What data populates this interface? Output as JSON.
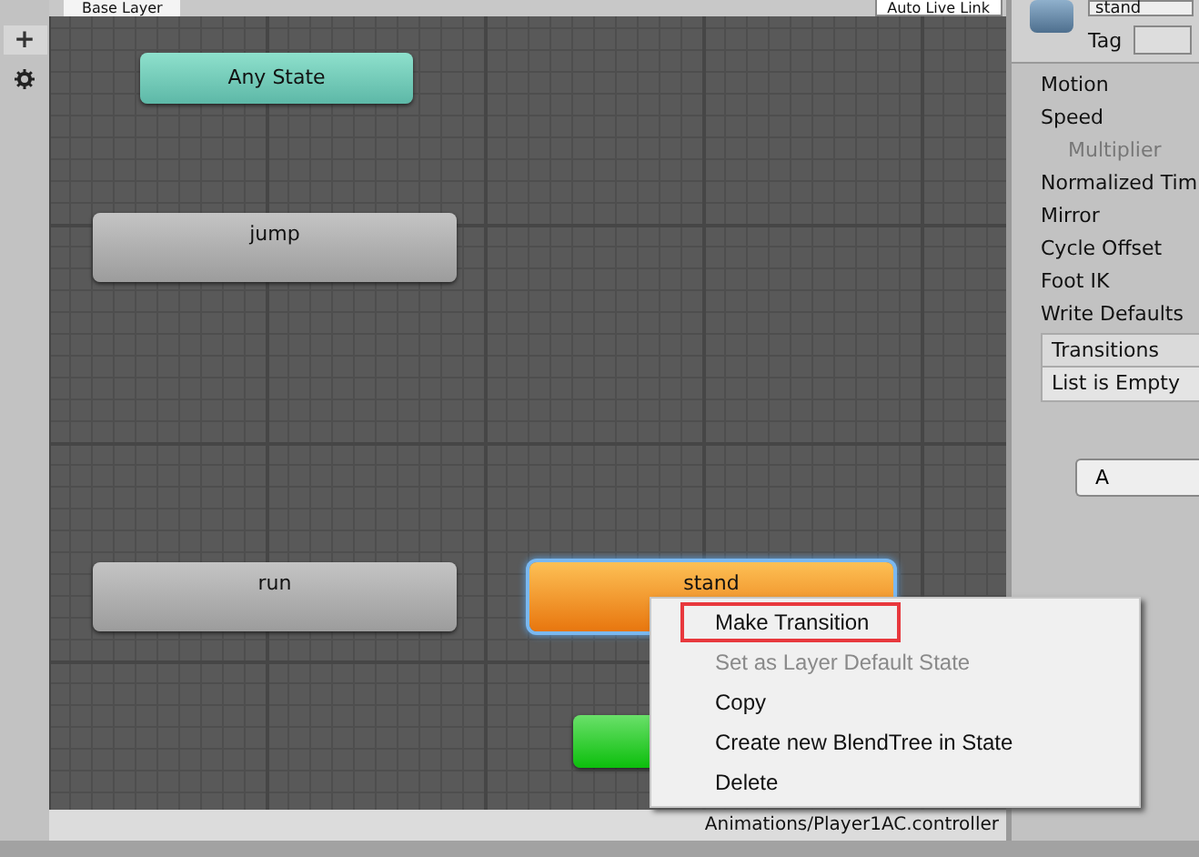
{
  "tabs": [
    {
      "label": "Base Layer",
      "selected": true
    }
  ],
  "live_link": {
    "label": "Auto Live Link",
    "checked": false
  },
  "toolbar": {
    "add": "+"
  },
  "graph": {
    "nodes": [
      {
        "label": "Any State",
        "kind": "any",
        "selected": false
      },
      {
        "label": "jump",
        "kind": "normal",
        "selected": false
      },
      {
        "label": "run",
        "kind": "normal",
        "selected": false
      },
      {
        "label": "stand",
        "kind": "default",
        "selected": true
      },
      {
        "kind": "entry",
        "selected": false
      }
    ]
  },
  "context_menu": [
    {
      "label": "Make Transition",
      "disabled": false,
      "marked": true
    },
    {
      "label": "Set as Layer Default State",
      "disabled": true,
      "marked": false
    },
    {
      "label": "Copy",
      "disabled": false,
      "marked": false
    },
    {
      "label": "Create new BlendTree in State",
      "disabled": false,
      "marked": false
    },
    {
      "label": "Delete",
      "disabled": false,
      "marked": false
    }
  ],
  "status_bar": {
    "path": "Animations/Player1AC.controller"
  },
  "inspector": {
    "name": "stand",
    "tag_label": "Tag",
    "properties": [
      {
        "label": "Motion",
        "disabled": false
      },
      {
        "label": "Speed",
        "disabled": false
      },
      {
        "label": "Multiplier",
        "disabled": true
      },
      {
        "label": "Normalized Tim",
        "disabled": false
      },
      {
        "label": "Mirror",
        "disabled": false
      },
      {
        "label": "Cycle Offset",
        "disabled": false
      },
      {
        "label": "Foot IK",
        "disabled": false
      },
      {
        "label": "Write Defaults",
        "disabled": false
      }
    ],
    "transitions": {
      "header": "Transitions",
      "empty": "List is Empty"
    },
    "button": "A"
  }
}
